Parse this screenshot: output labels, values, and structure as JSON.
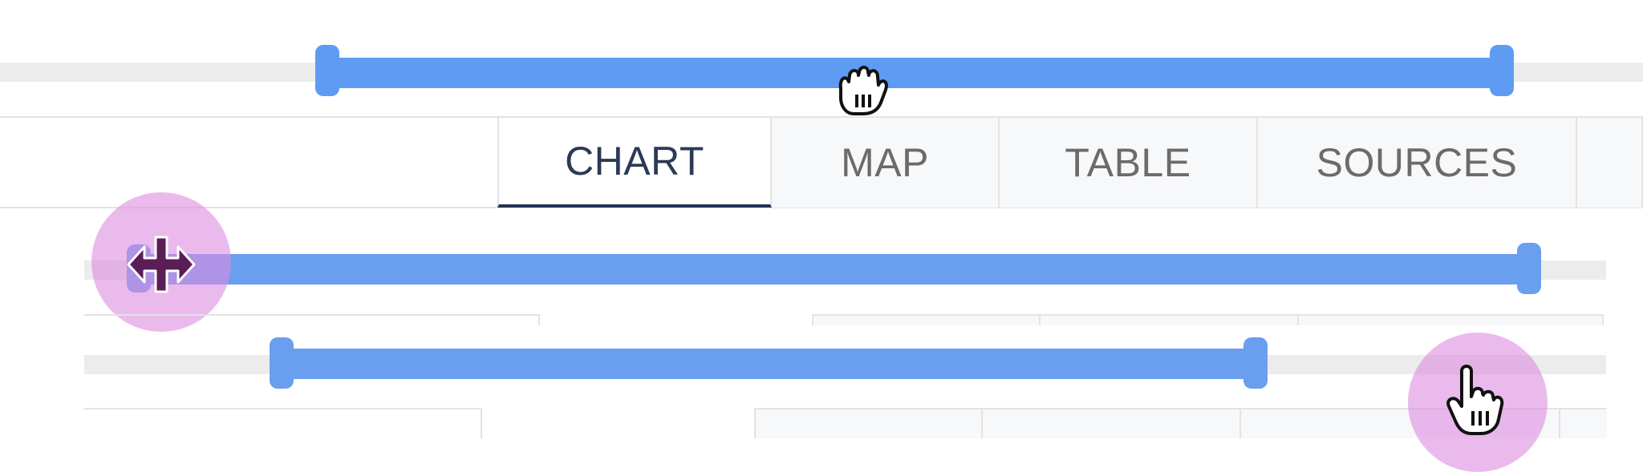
{
  "tabs": [
    {
      "label": "CHART",
      "active": true
    },
    {
      "label": "MAP",
      "active": false
    },
    {
      "label": "TABLE",
      "active": false
    },
    {
      "label": "SOURCES",
      "active": false
    }
  ],
  "cursors": {
    "top": "grab-hand-icon",
    "middle": "resize-horizontal-icon",
    "bottom": "pointer-hand-icon"
  },
  "colors": {
    "range": "#5d9cf2",
    "active_tab_text": "#2b3a55",
    "active_tab_underline": "#1f3354",
    "inactive_tab_text": "#6b6b6b",
    "highlight": "#dc8ce1"
  }
}
